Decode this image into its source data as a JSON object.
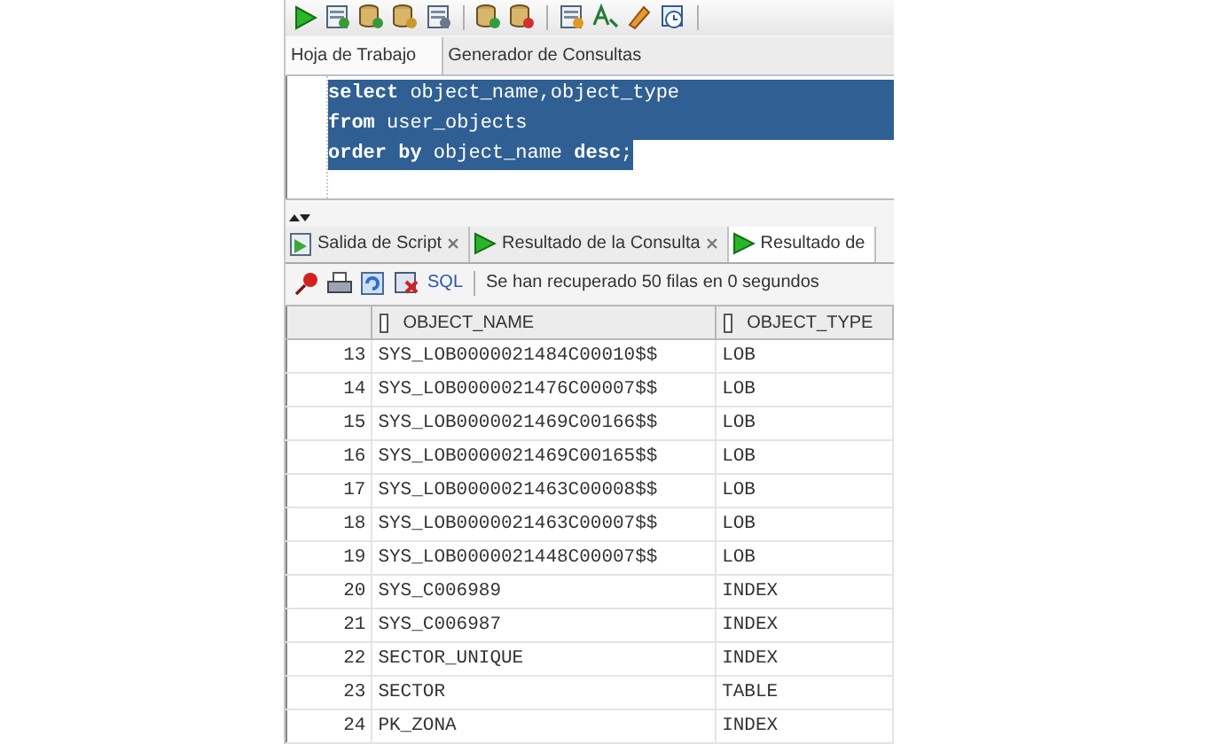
{
  "editor_tabs": [
    {
      "label": "Hoja de Trabajo",
      "selected": true
    },
    {
      "label": "Generador de Consultas",
      "selected": false
    }
  ],
  "editor": {
    "lines": [
      "**select** object_name,object_type",
      "**from** user_objects",
      "**order by** object_name **desc**;"
    ]
  },
  "result_tabs": [
    {
      "label": "Salida de Script",
      "selected": false,
      "closable": true,
      "kind": "script"
    },
    {
      "label": "Resultado de la Consulta",
      "selected": false,
      "closable": true,
      "kind": "query"
    },
    {
      "label": "Resultado de",
      "selected": true,
      "closable": false,
      "kind": "query"
    }
  ],
  "result_toolbar": {
    "sql_link": "SQL",
    "status": "Se han recuperado 50 filas en 0 segundos"
  },
  "table": {
    "columns": [
      "OBJECT_NAME",
      "OBJECT_TYPE"
    ],
    "rows": [
      {
        "number": "13",
        "cells": [
          "SYS_LOB0000021484C00010$$",
          "LOB"
        ]
      },
      {
        "number": "14",
        "cells": [
          "SYS_LOB0000021476C00007$$",
          "LOB"
        ]
      },
      {
        "number": "15",
        "cells": [
          "SYS_LOB0000021469C00166$$",
          "LOB"
        ]
      },
      {
        "number": "16",
        "cells": [
          "SYS_LOB0000021469C00165$$",
          "LOB"
        ]
      },
      {
        "number": "17",
        "cells": [
          "SYS_LOB0000021463C00008$$",
          "LOB"
        ]
      },
      {
        "number": "18",
        "cells": [
          "SYS_LOB0000021463C00007$$",
          "LOB"
        ]
      },
      {
        "number": "19",
        "cells": [
          "SYS_LOB0000021448C00007$$",
          "LOB"
        ]
      },
      {
        "number": "20",
        "cells": [
          "SYS_C006989",
          "INDEX"
        ]
      },
      {
        "number": "21",
        "cells": [
          "SYS_C006987",
          "INDEX"
        ]
      },
      {
        "number": "22",
        "cells": [
          "SECTOR_UNIQUE",
          "INDEX"
        ]
      },
      {
        "number": "23",
        "cells": [
          "SECTOR",
          "TABLE"
        ]
      },
      {
        "number": "24",
        "cells": [
          "PK_ZONA",
          "INDEX"
        ]
      }
    ]
  }
}
